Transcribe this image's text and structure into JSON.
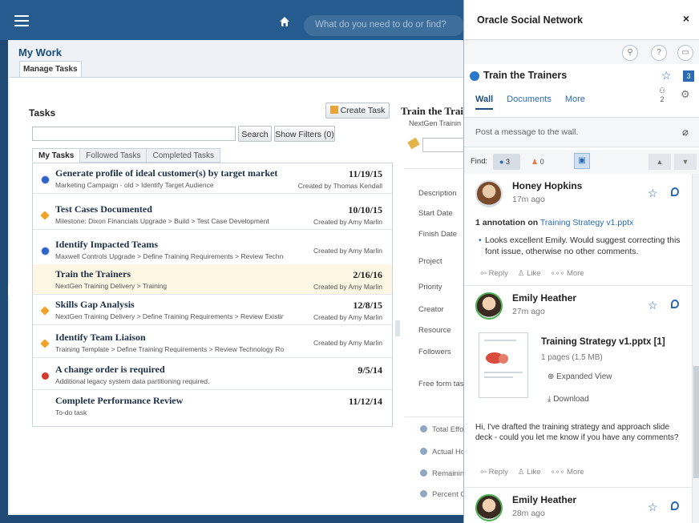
{
  "header": {
    "search_placeholder": "What do you need to do or find?"
  },
  "page": {
    "title": "My Work",
    "tab": "Manage Tasks"
  },
  "tasks": {
    "heading": "Tasks",
    "create_label": "Create Task",
    "search_label": "Search",
    "filters_label": "Show Filters (0)",
    "subtabs": [
      "My Tasks",
      "Followed Tasks",
      "Completed Tasks"
    ],
    "rows": [
      {
        "title": "Generate profile of ideal customer(s) by target market",
        "sub": "Marketing Campaign - old > Identify Target Audience",
        "date": "11/19/15",
        "by": "Created by Thomas Kendall",
        "icon": "blue"
      },
      {
        "title": "Test Cases Documented",
        "sub": "Milestone: Dixon Financials Upgrade > Build > Test Case Development",
        "date": "10/10/15",
        "by": "Created by Amy Marlin",
        "icon": "orange"
      },
      {
        "title": "Identify Impacted Teams",
        "sub": "Maxwell Controls Upgrade > Define Training Requirements > Review Technolo...",
        "date": "",
        "by": "Created by Amy Marlin",
        "icon": "blue"
      },
      {
        "title": "Train the Trainers",
        "sub": "NextGen Training Delivery > Training",
        "date": "2/16/16",
        "by": "Created by Amy Marlin",
        "icon": "none"
      },
      {
        "title": "Skills Gap Analysis",
        "sub": "NextGen Training Delivery > Define Training Requirements > Review Existin...",
        "date": "12/8/15",
        "by": "Created by Amy Marlin",
        "icon": "orange"
      },
      {
        "title": "Identify Team Liaison",
        "sub": "Training Template > Define Training Requirements > Review Technology Roadmap",
        "date": "",
        "by": "Created by Amy Marlin",
        "icon": "orange"
      },
      {
        "title": "A change order is required",
        "sub": "Additional legacy system data partitioning required.",
        "date": "9/5/14",
        "by": "",
        "icon": "red"
      },
      {
        "title": "Complete Performance Review",
        "sub": "To-do task",
        "date": "11/12/14",
        "by": "",
        "icon": "none"
      }
    ]
  },
  "detail": {
    "title": "Train the Trai",
    "subtitle": "NextGen Trainin",
    "labels": [
      "Description",
      "Start Date",
      "Finish Date",
      "Project",
      "Priority",
      "Creator",
      "Resource",
      "Followers",
      "Free form tas"
    ],
    "summary": [
      "Total Effo",
      "Actual Ho",
      "Remainin",
      "Percent C"
    ]
  },
  "osn": {
    "title": "Oracle Social Network",
    "close": "×",
    "conversation": "Train the Trainers",
    "badge": "3",
    "members": "2",
    "wall_tabs": [
      "Wall",
      "Documents",
      "More"
    ],
    "post_placeholder": "Post a message to the wall.",
    "find_label": "Find:",
    "find_count_a": "3",
    "find_count_b": "0",
    "items": [
      {
        "name": "Honey Hopkins",
        "time": "17m ago",
        "annotation": "1 annotation on",
        "doc_link": "Training Strategy v1.pptx",
        "comment": "Looks excellent Emily.  Would suggest correcting this font issue, otherwise no other comments."
      },
      {
        "name": "Emily Heather",
        "time": "27m ago",
        "doc_title": "Training Strategy v1.pptx [1]",
        "doc_meta": "1 pages (1.5 MB)",
        "expanded": "Expanded View",
        "download": "Download",
        "message": "Hi, I've drafted the training strategy and approach slide deck - could you let me know if you have any comments?"
      },
      {
        "name": "Emily Heather",
        "time": "28m ago"
      }
    ],
    "actions": {
      "reply": "Reply",
      "like": "Like",
      "more": "More"
    }
  }
}
